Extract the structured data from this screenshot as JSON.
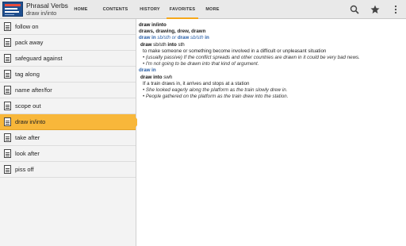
{
  "app": {
    "title": "Phrasal Verbs",
    "subtitle": "draw in/into",
    "icon": "dictionary-app-icon"
  },
  "tabs": [
    {
      "label": "HOME",
      "active": false
    },
    {
      "label": "CONTENTS",
      "active": false
    },
    {
      "label": "HISTORY",
      "active": false
    },
    {
      "label": "FAVORITES",
      "active": true
    },
    {
      "label": "MORE",
      "active": false
    }
  ],
  "actions": [
    "search-icon",
    "star-icon",
    "overflow-menu-icon"
  ],
  "colors": {
    "accent": "#f6a81b",
    "selected": "#f8b73a",
    "link": "#2a60a8"
  },
  "sidebar": {
    "items": [
      {
        "label": "follow on"
      },
      {
        "label": "pack away"
      },
      {
        "label": "safeguard against"
      },
      {
        "label": "tag along"
      },
      {
        "label": "name after/for"
      },
      {
        "label": "scope out"
      },
      {
        "label": "draw in/into",
        "selected": true
      },
      {
        "label": "take after"
      },
      {
        "label": "look after"
      },
      {
        "label": "piss off"
      }
    ]
  },
  "entry": {
    "headword": "draw in/into",
    "forms": "draws, drawing, drew, drawn",
    "sense1": {
      "header_a": "draw in",
      "header_b": " sb/sth ",
      "header_c": "or ",
      "header_d": "draw",
      "header_e": " sb/sth ",
      "header_f": "in",
      "pattern_a": "draw",
      "pattern_b": " sb/sth ",
      "pattern_c": "into",
      "pattern_d": " sth",
      "definition": "to make someone or something become involved in a difficult or unpleasant situation",
      "ex1": "• (usually passive) If the conflict spreads and other countries are drawn in it could be very bad news.",
      "ex2": "• I'm not going to be drawn into that kind of argument."
    },
    "sense2": {
      "header": "draw in",
      "pattern_a": "draw into",
      "pattern_b": " swh",
      "definition": "If a train draws in, it arrives and stops at a station",
      "ex1": "• She looked eagerly along the platform as the train slowly drew in.",
      "ex2": "• People gathered on the platform as the train drew into the station."
    }
  }
}
